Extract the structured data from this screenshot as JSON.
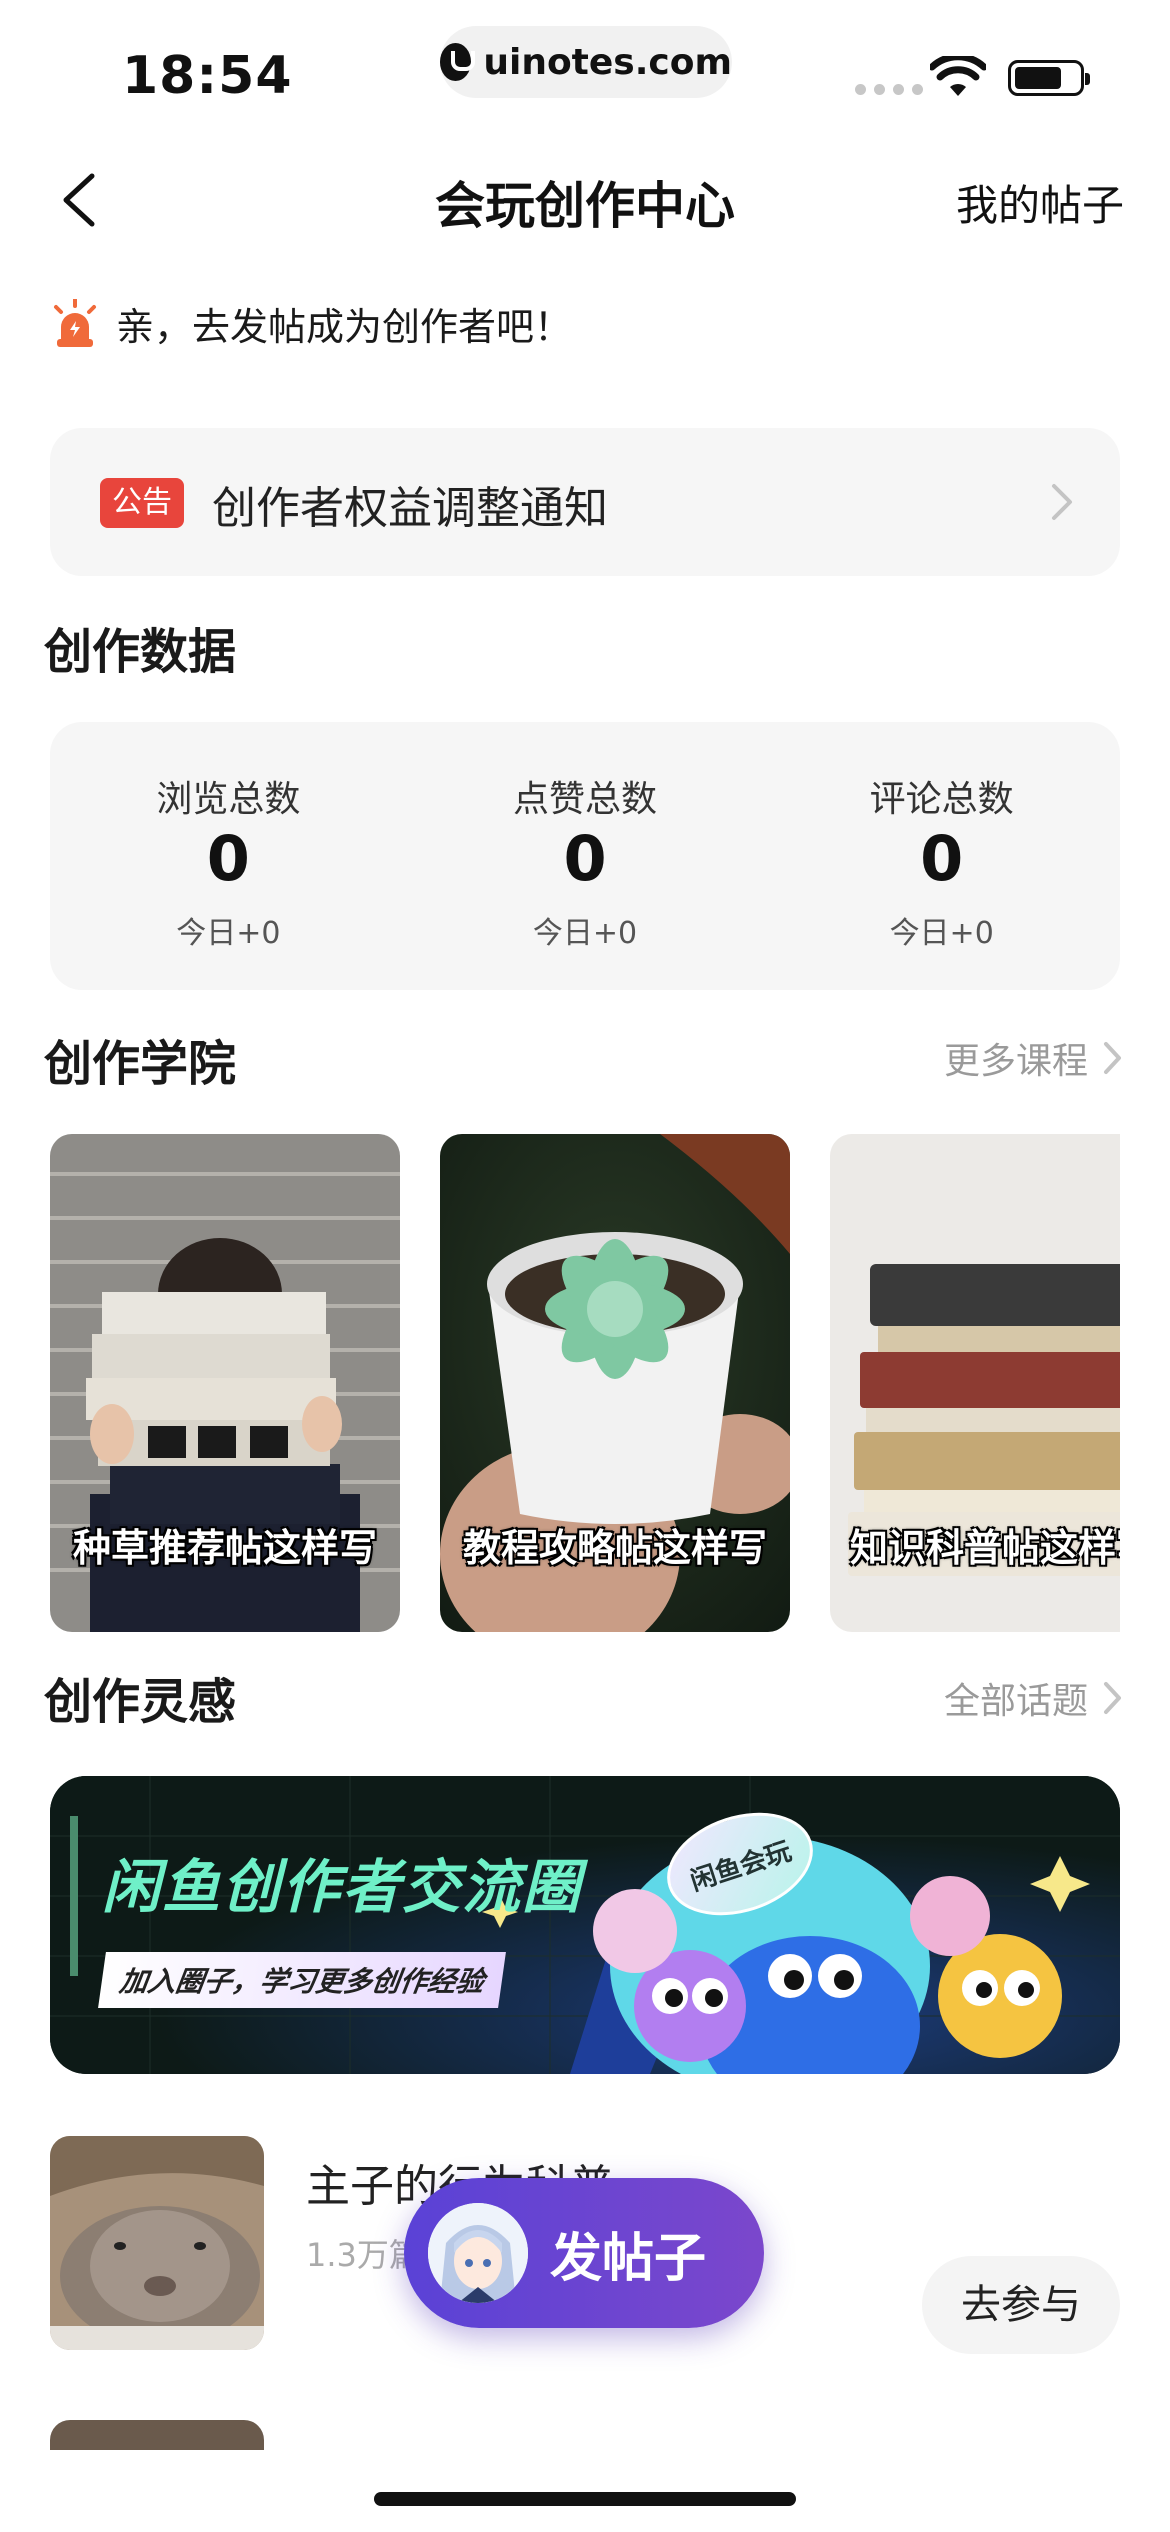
{
  "status_bar": {
    "time": "18:54",
    "url": "uinotes.com"
  },
  "nav": {
    "title": "会玩创作中心",
    "right_link": "我的帖子"
  },
  "tip": {
    "text": "亲，去发帖成为创作者吧！"
  },
  "notice": {
    "badge": "公告",
    "text": "创作者权益调整通知"
  },
  "creation_data": {
    "title": "创作数据",
    "stats": [
      {
        "label": "浏览总数",
        "value": "0",
        "today": "今日+0"
      },
      {
        "label": "点赞总数",
        "value": "0",
        "today": "今日+0"
      },
      {
        "label": "评论总数",
        "value": "0",
        "today": "今日+0"
      }
    ]
  },
  "academy": {
    "title": "创作学院",
    "more": "更多课程",
    "courses": [
      {
        "label": "种草推荐帖这样写"
      },
      {
        "label": "教程攻略帖这样写"
      },
      {
        "label": "知识科普帖这样写"
      }
    ]
  },
  "inspiration": {
    "title": "创作灵感",
    "more": "全部话题",
    "banner": {
      "title": "闲鱼创作者交流圈",
      "subtitle": "加入圈子，学习更多创作经验",
      "badge": "闲鱼会玩"
    },
    "topics": [
      {
        "title": "主子的行为科普",
        "count": "1.3万篇",
        "button": "去参与"
      }
    ]
  },
  "fab": {
    "label": "发帖子"
  },
  "colors": {
    "accent_red": "#e8453c",
    "fab_start": "#5a42d6",
    "fab_end": "#7b47cc",
    "banner_title": "#6ff0c8"
  }
}
